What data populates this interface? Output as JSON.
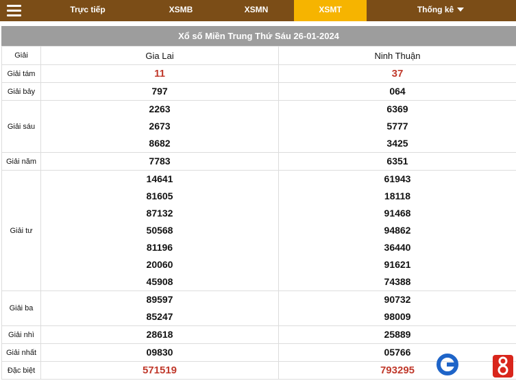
{
  "nav": {
    "items": [
      "Trực tiếp",
      "XSMB",
      "XSMN",
      "XSMT",
      "Thống kê"
    ],
    "active": "XSMT",
    "accent": "#f6b400",
    "bar_color": "#7b4d17"
  },
  "result": {
    "title": "Xổ số Miền Trung Thứ Sáu 26-01-2024",
    "header_label": "Giải",
    "provinces": [
      "Gia Lai",
      "Ninh Thuận"
    ],
    "prizes": [
      {
        "label": "Giải tám",
        "values": [
          [
            "11"
          ],
          [
            "37"
          ]
        ],
        "highlight": true
      },
      {
        "label": "Giải bảy",
        "values": [
          [
            "797"
          ],
          [
            "064"
          ]
        ]
      },
      {
        "label": "Giải sáu",
        "values": [
          [
            "2263",
            "2673",
            "8682"
          ],
          [
            "6369",
            "5777",
            "3425"
          ]
        ]
      },
      {
        "label": "Giải năm",
        "values": [
          [
            "7783"
          ],
          [
            "6351"
          ]
        ]
      },
      {
        "label": "Giải tư",
        "values": [
          [
            "14641",
            "81605",
            "87132",
            "50568",
            "81196",
            "20060",
            "45908"
          ],
          [
            "61943",
            "18118",
            "91468",
            "94862",
            "36440",
            "91621",
            "74388"
          ]
        ]
      },
      {
        "label": "Giải ba",
        "values": [
          [
            "89597",
            "85247"
          ],
          [
            "90732",
            "98009"
          ]
        ]
      },
      {
        "label": "Giải nhì",
        "values": [
          [
            "28618"
          ],
          [
            "25889"
          ]
        ]
      },
      {
        "label": "Giải nhất",
        "values": [
          [
            "09830"
          ],
          [
            "05766"
          ]
        ]
      },
      {
        "label": "Đặc biệt",
        "values": [
          [
            "571519"
          ],
          [
            "793295"
          ]
        ],
        "highlight": true
      }
    ],
    "highlight_color": "#c0392b"
  }
}
